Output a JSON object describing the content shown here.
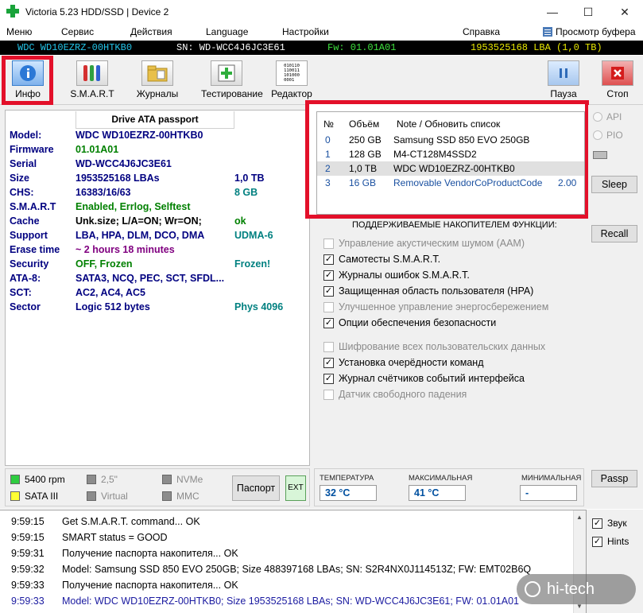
{
  "window": {
    "title": "Victoria 5.23 HDD/SSD | Device 2",
    "controls": {
      "minimize": "—",
      "maximize": "☐",
      "close": "✕"
    }
  },
  "menubar": {
    "items": [
      "Меню",
      "Сервис",
      "Действия",
      "Language",
      "Настройки",
      "Справка"
    ],
    "buffer_view": "Просмотр буфера"
  },
  "device_bar": {
    "model": "WDC WD10EZRZ-00HTKB0",
    "serial": "SN: WD-WCC4J6JC3E61",
    "firmware": "Fw: 01.01A01",
    "lba": "1953525168 LBA (1,0 TB)"
  },
  "toolbar": {
    "info": "Инфо",
    "smart": "S.M.A.R.T",
    "logs": "Журналы",
    "testing": "Тестирование",
    "editor": "Редактор",
    "pause": "Пауза",
    "stop": "Стоп",
    "editor_icon_text": "010110\n110011\n101000\n0001"
  },
  "passport": {
    "title": "Drive ATA passport",
    "rows": [
      {
        "key": "Model:",
        "value": "WDC WD10EZRZ-00HTKB0",
        "extra": "",
        "value_color": "#000080",
        "extra_color": ""
      },
      {
        "key": "Firmware",
        "value": "01.01A01",
        "extra": "",
        "value_color": "#008000",
        "extra_color": ""
      },
      {
        "key": "Serial",
        "value": "WD-WCC4J6JC3E61",
        "extra": "",
        "value_color": "#000080",
        "extra_color": ""
      },
      {
        "key": "Size",
        "value": "1953525168 LBAs",
        "extra": "1,0 TB",
        "value_color": "#000080",
        "extra_color": "#000080"
      },
      {
        "key": "CHS:",
        "value": "16383/16/63",
        "extra": "8 GB",
        "value_color": "#000080",
        "extra_color": "#008080"
      },
      {
        "key": "S.M.A.R.T",
        "value": "Enabled, Errlog, Selftest",
        "extra": "",
        "value_color": "#008000",
        "extra_color": ""
      },
      {
        "key": "Cache",
        "value": "Unk.size; L/A=ON; Wr=ON;",
        "extra": "ok",
        "value_color": "#000000",
        "extra_color": "#008000"
      },
      {
        "key": "Support",
        "value": "LBA, HPA, DLM, DCO, DMA",
        "extra": "UDMA-6",
        "value_color": "#000080",
        "extra_color": "#008080"
      },
      {
        "key": "Erase time",
        "value": "~ 2 hours 18 minutes",
        "extra": "",
        "value_color": "#800080",
        "extra_color": ""
      },
      {
        "key": "Security",
        "value": "OFF, Frozen",
        "extra": "Frozen!",
        "value_color": "#008000",
        "extra_color": "#008080"
      },
      {
        "key": "ATA-8:",
        "value": "SATA3, NCQ, PEC, SCT, SFDL...",
        "extra": "",
        "value_color": "#000080",
        "extra_color": ""
      },
      {
        "key": "SCT:",
        "value": "AC2, AC4, AC5",
        "extra": "",
        "value_color": "#000080",
        "extra_color": ""
      },
      {
        "key": "Sector",
        "value": "Logic 512 bytes",
        "extra": "Phys 4096",
        "value_color": "#000080",
        "extra_color": "#008080"
      }
    ]
  },
  "drive_list": {
    "headers": {
      "no": "№",
      "size": "Объём",
      "note": "Note / Обновить список"
    },
    "rows": [
      {
        "no": "0",
        "size": "250 GB",
        "note": "Samsung SSD 850 EVO 250GB",
        "extra": "",
        "selected": false
      },
      {
        "no": "1",
        "size": "128 GB",
        "note": "M4-CT128M4SSD2",
        "extra": "",
        "selected": false
      },
      {
        "no": "2",
        "size": "1,0 TB",
        "note": "WDC WD10EZRZ-00HTKB0",
        "extra": "",
        "selected": true
      },
      {
        "no": "3",
        "size": "16 GB",
        "note": "Removable VendorCoProductCode",
        "extra": "2.00",
        "selected": false
      }
    ]
  },
  "features": {
    "title": "ПОДДЕРЖИВАЕМЫЕ НАКОПИТЕЛЕМ ФУНКЦИИ:",
    "items": [
      {
        "label": "Управление акустическим шумом (AAM)",
        "checked": false,
        "enabled": false
      },
      {
        "label": "Самотесты S.M.A.R.T.",
        "checked": true,
        "enabled": true
      },
      {
        "label": "Журналы ошибок S.M.A.R.T.",
        "checked": true,
        "enabled": true
      },
      {
        "label": "Защищенная область пользователя (HPA)",
        "checked": true,
        "enabled": true
      },
      {
        "label": "Улучшенное управление энергосбережением",
        "checked": false,
        "enabled": false
      },
      {
        "label": "Опции обеспечения безопасности",
        "checked": true,
        "enabled": true
      },
      {
        "label": "Шифрование всех пользовательских данных",
        "checked": false,
        "enabled": false
      },
      {
        "label": "Установка очерёдности команд",
        "checked": true,
        "enabled": true
      },
      {
        "label": "Журнал счётчиков событий интерфейса",
        "checked": true,
        "enabled": true
      },
      {
        "label": "Датчик свободного падения",
        "checked": false,
        "enabled": false
      }
    ]
  },
  "right_panel": {
    "api": "API",
    "pio": "PIO",
    "sleep": "Sleep",
    "recall": "Recall",
    "passp": "Passp"
  },
  "info_strip": {
    "rpm": "5400 rpm",
    "sata": "SATA III",
    "form": "2,5\"",
    "virtual": "Virtual",
    "nvme": "NVMe",
    "mmc": "MMC",
    "passport_btn": "Паспорт",
    "ext_btn": "EXT",
    "colors": {
      "green": "#2ecc40",
      "yellow": "#ffff33",
      "gray": "#8c8c8c"
    }
  },
  "temps": {
    "current_label": "ТЕМПЕРАТУРА",
    "current": "32 °C",
    "max_label": "МАКСИМАЛЬНАЯ",
    "max": "41 °C",
    "min_label": "МИНИМАЛЬНАЯ",
    "min": "-"
  },
  "log": {
    "rows": [
      {
        "time": "9:59:15",
        "msg": "Get S.M.A.R.T. command... OK",
        "color": "#000000"
      },
      {
        "time": "9:59:15",
        "msg": "SMART status = GOOD",
        "color": "#000000"
      },
      {
        "time": "9:59:31",
        "msg": "Получение паспорта накопителя... OK",
        "color": "#000000"
      },
      {
        "time": "9:59:32",
        "msg": "Model: Samsung SSD 850 EVO 250GB; Size 488397168 LBAs; SN: S2R4NX0J114513Z; FW: EMT02B6Q",
        "color": "#000000"
      },
      {
        "time": "9:59:33",
        "msg": "Получение паспорта накопителя... OK",
        "color": "#000000"
      },
      {
        "time": "9:59:33",
        "msg": "Model: WDC WD10EZRZ-00HTKB0; Size 1953525168 LBAs; SN: WD-WCC4J6JC3E61; FW: 01.01A01",
        "color": "#1a1aa0"
      }
    ],
    "sound": "Звук",
    "hints": "Hints"
  },
  "watermark": "hi-tech"
}
